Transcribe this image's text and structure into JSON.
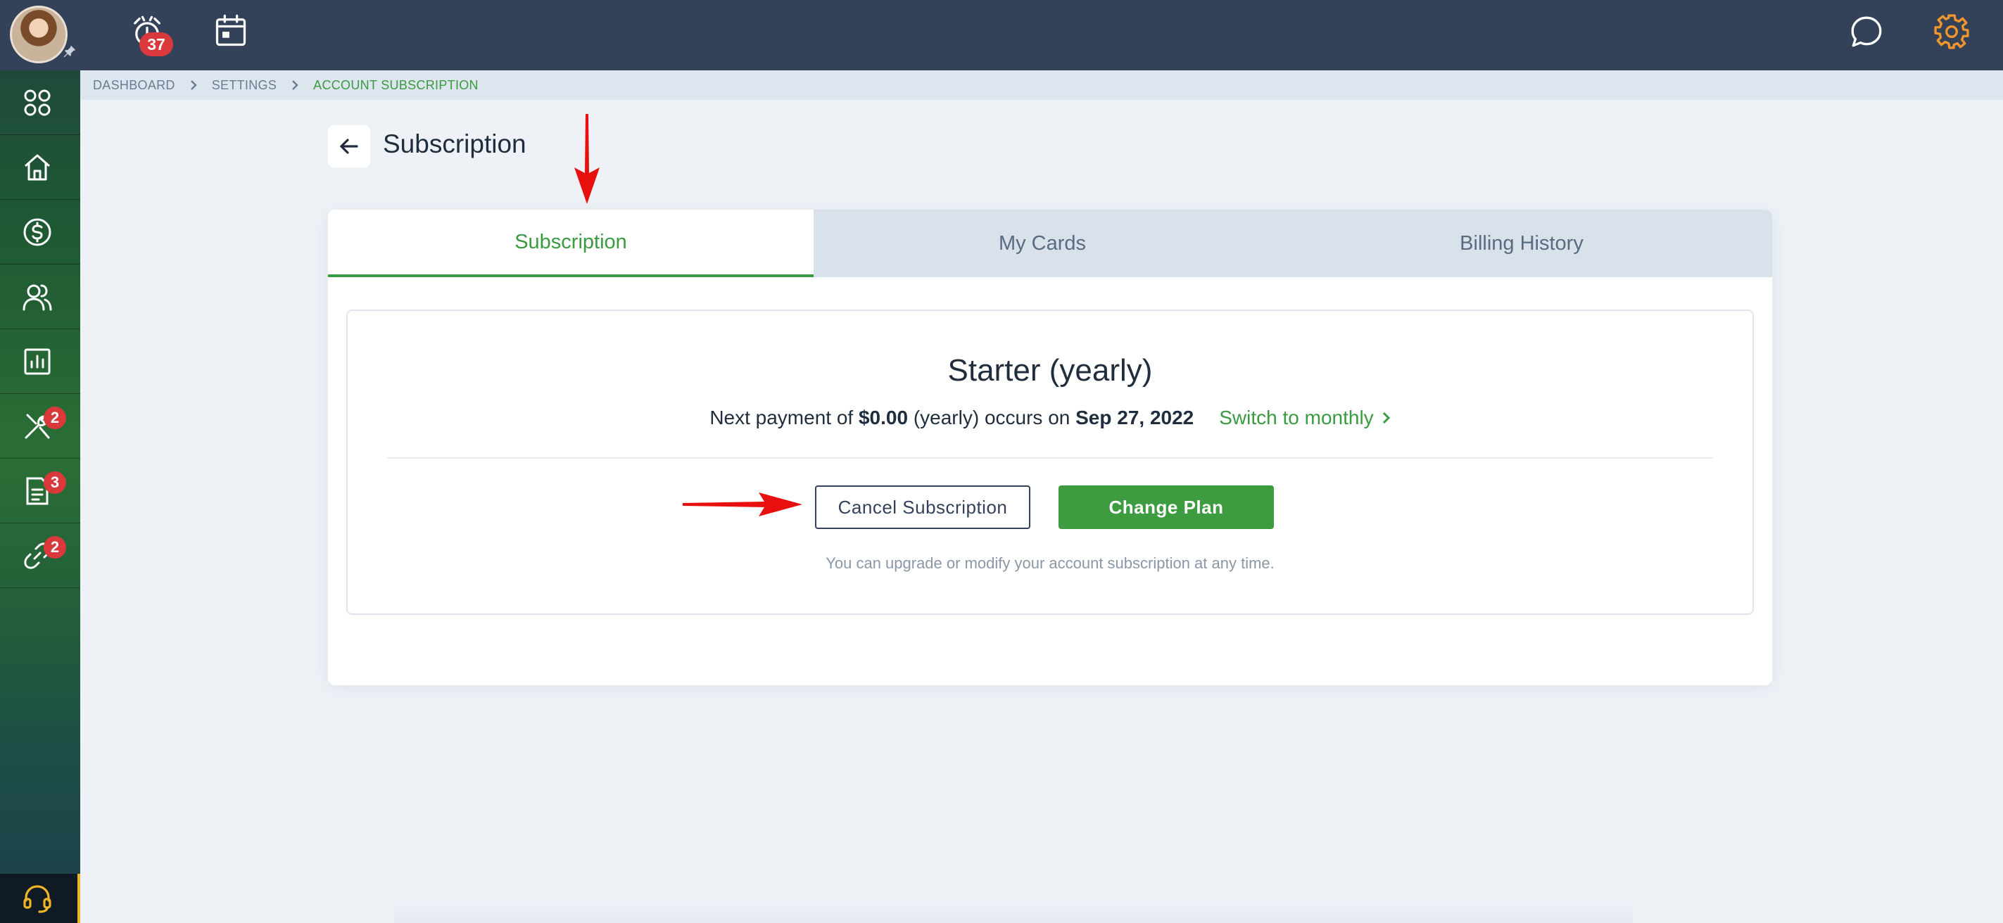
{
  "topbar": {
    "notification_count": "37",
    "icons": [
      "user-avatar",
      "alarm-clock-icon",
      "calendar-icon",
      "chat-icon",
      "gear-icon"
    ]
  },
  "sidebar": {
    "items": [
      {
        "icon": "grid-icon",
        "badge": ""
      },
      {
        "icon": "home-icon",
        "badge": ""
      },
      {
        "icon": "dollar-icon",
        "badge": ""
      },
      {
        "icon": "users-icon",
        "badge": ""
      },
      {
        "icon": "chart-icon",
        "badge": ""
      },
      {
        "icon": "tools-icon",
        "badge": "2"
      },
      {
        "icon": "document-icon",
        "badge": "3"
      },
      {
        "icon": "link-icon",
        "badge": "2"
      }
    ],
    "support_icon": "headset-icon"
  },
  "breadcrumb": {
    "items": [
      "DASHBOARD",
      "SETTINGS",
      "ACCOUNT SUBSCRIPTION"
    ]
  },
  "page": {
    "title": "Subscription"
  },
  "tabs": {
    "items": [
      "Subscription",
      "My Cards",
      "Billing History"
    ],
    "active": "Subscription"
  },
  "subscription": {
    "plan_name": "Starter (yearly)",
    "payment_prefix": "Next payment of ",
    "amount": "$0.00",
    "payment_middle": " (yearly) occurs on ",
    "date": "Sep 27, 2022",
    "switch_label": "Switch to monthly",
    "cancel_label": "Cancel Subscription",
    "change_label": "Change Plan",
    "hint": "You can upgrade or modify your account subscription at any time."
  },
  "colors": {
    "topbar": "#344259",
    "accent_green": "#3a9a3f",
    "badge_red": "#d9393b",
    "annotation_red": "#e8100f",
    "settings_orange": "#f0962a"
  }
}
